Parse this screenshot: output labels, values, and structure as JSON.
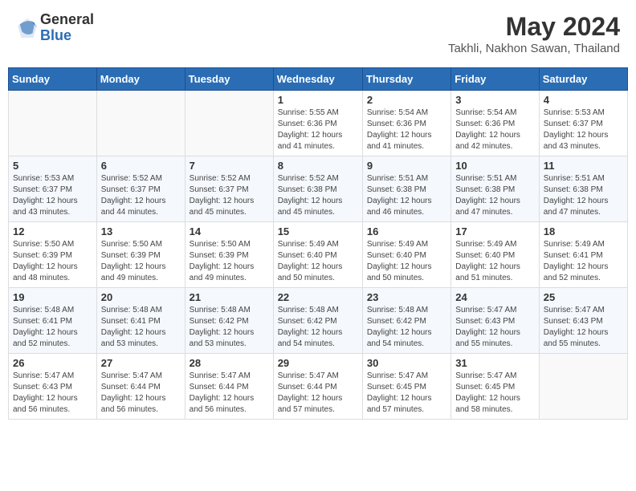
{
  "header": {
    "logo_general": "General",
    "logo_blue": "Blue",
    "main_title": "May 2024",
    "subtitle": "Takhli, Nakhon Sawan, Thailand"
  },
  "calendar": {
    "days_of_week": [
      "Sunday",
      "Monday",
      "Tuesday",
      "Wednesday",
      "Thursday",
      "Friday",
      "Saturday"
    ],
    "weeks": [
      [
        {
          "day": "",
          "info": ""
        },
        {
          "day": "",
          "info": ""
        },
        {
          "day": "",
          "info": ""
        },
        {
          "day": "1",
          "info": "Sunrise: 5:55 AM\nSunset: 6:36 PM\nDaylight: 12 hours\nand 41 minutes."
        },
        {
          "day": "2",
          "info": "Sunrise: 5:54 AM\nSunset: 6:36 PM\nDaylight: 12 hours\nand 41 minutes."
        },
        {
          "day": "3",
          "info": "Sunrise: 5:54 AM\nSunset: 6:36 PM\nDaylight: 12 hours\nand 42 minutes."
        },
        {
          "day": "4",
          "info": "Sunrise: 5:53 AM\nSunset: 6:37 PM\nDaylight: 12 hours\nand 43 minutes."
        }
      ],
      [
        {
          "day": "5",
          "info": "Sunrise: 5:53 AM\nSunset: 6:37 PM\nDaylight: 12 hours\nand 43 minutes."
        },
        {
          "day": "6",
          "info": "Sunrise: 5:52 AM\nSunset: 6:37 PM\nDaylight: 12 hours\nand 44 minutes."
        },
        {
          "day": "7",
          "info": "Sunrise: 5:52 AM\nSunset: 6:37 PM\nDaylight: 12 hours\nand 45 minutes."
        },
        {
          "day": "8",
          "info": "Sunrise: 5:52 AM\nSunset: 6:38 PM\nDaylight: 12 hours\nand 45 minutes."
        },
        {
          "day": "9",
          "info": "Sunrise: 5:51 AM\nSunset: 6:38 PM\nDaylight: 12 hours\nand 46 minutes."
        },
        {
          "day": "10",
          "info": "Sunrise: 5:51 AM\nSunset: 6:38 PM\nDaylight: 12 hours\nand 47 minutes."
        },
        {
          "day": "11",
          "info": "Sunrise: 5:51 AM\nSunset: 6:38 PM\nDaylight: 12 hours\nand 47 minutes."
        }
      ],
      [
        {
          "day": "12",
          "info": "Sunrise: 5:50 AM\nSunset: 6:39 PM\nDaylight: 12 hours\nand 48 minutes."
        },
        {
          "day": "13",
          "info": "Sunrise: 5:50 AM\nSunset: 6:39 PM\nDaylight: 12 hours\nand 49 minutes."
        },
        {
          "day": "14",
          "info": "Sunrise: 5:50 AM\nSunset: 6:39 PM\nDaylight: 12 hours\nand 49 minutes."
        },
        {
          "day": "15",
          "info": "Sunrise: 5:49 AM\nSunset: 6:40 PM\nDaylight: 12 hours\nand 50 minutes."
        },
        {
          "day": "16",
          "info": "Sunrise: 5:49 AM\nSunset: 6:40 PM\nDaylight: 12 hours\nand 50 minutes."
        },
        {
          "day": "17",
          "info": "Sunrise: 5:49 AM\nSunset: 6:40 PM\nDaylight: 12 hours\nand 51 minutes."
        },
        {
          "day": "18",
          "info": "Sunrise: 5:49 AM\nSunset: 6:41 PM\nDaylight: 12 hours\nand 52 minutes."
        }
      ],
      [
        {
          "day": "19",
          "info": "Sunrise: 5:48 AM\nSunset: 6:41 PM\nDaylight: 12 hours\nand 52 minutes."
        },
        {
          "day": "20",
          "info": "Sunrise: 5:48 AM\nSunset: 6:41 PM\nDaylight: 12 hours\nand 53 minutes."
        },
        {
          "day": "21",
          "info": "Sunrise: 5:48 AM\nSunset: 6:42 PM\nDaylight: 12 hours\nand 53 minutes."
        },
        {
          "day": "22",
          "info": "Sunrise: 5:48 AM\nSunset: 6:42 PM\nDaylight: 12 hours\nand 54 minutes."
        },
        {
          "day": "23",
          "info": "Sunrise: 5:48 AM\nSunset: 6:42 PM\nDaylight: 12 hours\nand 54 minutes."
        },
        {
          "day": "24",
          "info": "Sunrise: 5:47 AM\nSunset: 6:43 PM\nDaylight: 12 hours\nand 55 minutes."
        },
        {
          "day": "25",
          "info": "Sunrise: 5:47 AM\nSunset: 6:43 PM\nDaylight: 12 hours\nand 55 minutes."
        }
      ],
      [
        {
          "day": "26",
          "info": "Sunrise: 5:47 AM\nSunset: 6:43 PM\nDaylight: 12 hours\nand 56 minutes."
        },
        {
          "day": "27",
          "info": "Sunrise: 5:47 AM\nSunset: 6:44 PM\nDaylight: 12 hours\nand 56 minutes."
        },
        {
          "day": "28",
          "info": "Sunrise: 5:47 AM\nSunset: 6:44 PM\nDaylight: 12 hours\nand 56 minutes."
        },
        {
          "day": "29",
          "info": "Sunrise: 5:47 AM\nSunset: 6:44 PM\nDaylight: 12 hours\nand 57 minutes."
        },
        {
          "day": "30",
          "info": "Sunrise: 5:47 AM\nSunset: 6:45 PM\nDaylight: 12 hours\nand 57 minutes."
        },
        {
          "day": "31",
          "info": "Sunrise: 5:47 AM\nSunset: 6:45 PM\nDaylight: 12 hours\nand 58 minutes."
        },
        {
          "day": "",
          "info": ""
        }
      ]
    ]
  }
}
